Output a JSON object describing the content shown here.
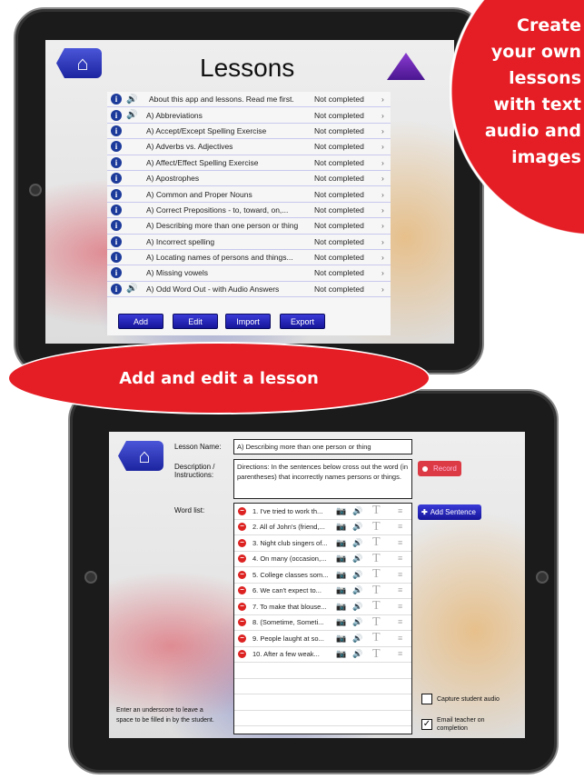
{
  "promo": {
    "circle_text": "Create your own lessons with text audio and images",
    "banner_text": "Add and edit a lesson",
    "accent": "#e51d24"
  },
  "lessons_screen": {
    "title": "Lessons",
    "rows": [
      {
        "title": "About this app and lessons. Read me first.",
        "status": "Not completed",
        "audio": true
      },
      {
        "title": "A) Abbreviations",
        "status": "Not completed",
        "audio": true
      },
      {
        "title": "A) Accept/Except Spelling Exercise",
        "status": "Not completed",
        "audio": false
      },
      {
        "title": "A) Adverbs vs. Adjectives",
        "status": "Not completed",
        "audio": false
      },
      {
        "title": "A) Affect/Effect Spelling Exercise",
        "status": "Not completed",
        "audio": false
      },
      {
        "title": "A) Apostrophes",
        "status": "Not completed",
        "audio": false
      },
      {
        "title": "A) Common and Proper Nouns",
        "status": "Not completed",
        "audio": false
      },
      {
        "title": "A) Correct Prepositions - to, toward, on,...",
        "status": "Not completed",
        "audio": false
      },
      {
        "title": "A) Describing more than one person or thing",
        "status": "Not completed",
        "audio": false
      },
      {
        "title": "A) Incorrect spelling",
        "status": "Not completed",
        "audio": false
      },
      {
        "title": "A) Locating names of persons and things...",
        "status": "Not completed",
        "audio": false
      },
      {
        "title": "A) Missing vowels",
        "status": "Not completed",
        "audio": false
      },
      {
        "title": "A) Odd Word Out - with Audio Answers",
        "status": "Not completed",
        "audio": true
      }
    ],
    "buttons": [
      "Add",
      "Edit",
      "Import",
      "Export"
    ]
  },
  "edit_screen": {
    "lesson_name_label": "Lesson Name:",
    "lesson_name_value": "A) Describing more than one person or thing",
    "description_label": "Description / Instructions:",
    "description_value": "Directions: In the sentences below cross out the word (in parentheses) that incorrectly names persons or things.",
    "record_label": "Record",
    "word_list_label": "Word list:",
    "add_sentence_label": "Add Sentence",
    "sentences": [
      "1. I've tried to work th...",
      "2. All of John's (friend,...",
      "3. Night club singers of...",
      "4. On many (occasion,...",
      "5. College classes som...",
      "6. We can't expect to...",
      "7. To make that blouse...",
      "8. (Sometime, Someti...",
      "9. People laught at so...",
      "10. After a few weak..."
    ],
    "hint": "Enter an underscore to leave a space to be filled in by the student.",
    "capture_audio_label": "Capture student audio",
    "capture_audio_checked": false,
    "email_teacher_label": "Email teacher on completion",
    "email_teacher_checked": true
  }
}
